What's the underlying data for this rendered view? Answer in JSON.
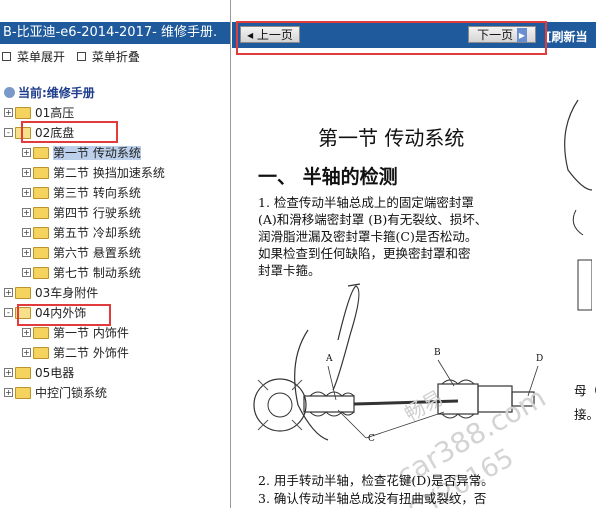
{
  "left": {
    "title": "B-比亚迪-e6-2014-2017- 维修手册.",
    "menu": {
      "expand": "菜单展开",
      "collapse": "菜单折叠"
    },
    "current": "当前:维修手册",
    "tree": [
      {
        "label": "01高压",
        "level": 0,
        "expander": "+"
      },
      {
        "label": "02底盘",
        "level": 0,
        "expander": "-"
      },
      {
        "label": "第一节 传动系统",
        "level": 1,
        "expander": "+",
        "selected": true
      },
      {
        "label": "第二节 换挡加速系统",
        "level": 1,
        "expander": "+"
      },
      {
        "label": "第三节 转向系统",
        "level": 1,
        "expander": "+"
      },
      {
        "label": "第四节 行驶系统",
        "level": 1,
        "expander": "+"
      },
      {
        "label": "第五节 冷却系统",
        "level": 1,
        "expander": "+"
      },
      {
        "label": "第六节 悬置系统",
        "level": 1,
        "expander": "+"
      },
      {
        "label": "第七节 制动系统",
        "level": 1,
        "expander": "+"
      },
      {
        "label": "03车身附件",
        "level": 0,
        "expander": "+"
      },
      {
        "label": "04内外饰",
        "level": 0,
        "expander": "-"
      },
      {
        "label": "第一节 内饰件",
        "level": 1,
        "expander": "+"
      },
      {
        "label": "第二节 外饰件",
        "level": 1,
        "expander": "+"
      },
      {
        "label": "05电器",
        "level": 0,
        "expander": "+"
      },
      {
        "label": "中控门锁系统",
        "level": 0,
        "expander": "+"
      }
    ]
  },
  "right": {
    "prev_label": "上一页",
    "next_label": "下一页",
    "refresh_label": "[刷新当",
    "doc": {
      "section_title": "第一节   传动系统",
      "subsection_title": "一、    半轴的检测",
      "para1_lines": [
        "1.    检查传动半轴总成上的固定端密封罩",
        "      (A)和滑移端密封罩 (B)有无裂纹、损坏、",
        "      润滑脂泄漏及密封罩卡箍(C)是否松动。",
        "      如果检查到任何缺陷，更换密封罩和密",
        "      封罩卡箍。"
      ],
      "labels": {
        "a": "A",
        "b": "B",
        "c": "C",
        "d": "D"
      },
      "side_text": {
        "line1": "母（",
        "line2": "接。"
      },
      "para2": "2.    用手转动半轴，检查花键(D)是否异常。",
      "para3": "3.    确认传动半轴总成没有扭曲或裂纹，否",
      "watermark": {
        "w1": "畅易",
        "w2": "car388.com",
        "w3": "CY20165"
      }
    }
  },
  "colors": {
    "bar": "#1e5a9c",
    "highlight": "#e23b3b",
    "selected": "#bcd0ec"
  }
}
